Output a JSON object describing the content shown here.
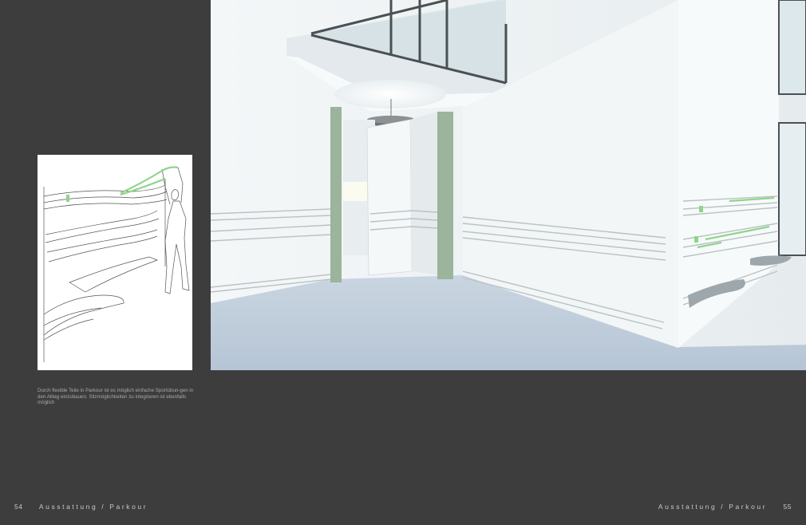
{
  "caption": "Durch flexible Teile in Parkour ist es möglich einfache Sportübun-gen in den Alltag einzubauen. Sitzmöglichkeiten zu integrieren ist ebenfalls möglich",
  "footer_left": {
    "page_number": "54",
    "section": "Ausstattung / Parkour"
  },
  "footer_right": {
    "page_number": "55",
    "section": "Ausstattung / Parkour"
  },
  "colors": {
    "page_background": "#3d3d3d",
    "accent_green": "#8fd58a",
    "column_green": "#9bb49b"
  }
}
